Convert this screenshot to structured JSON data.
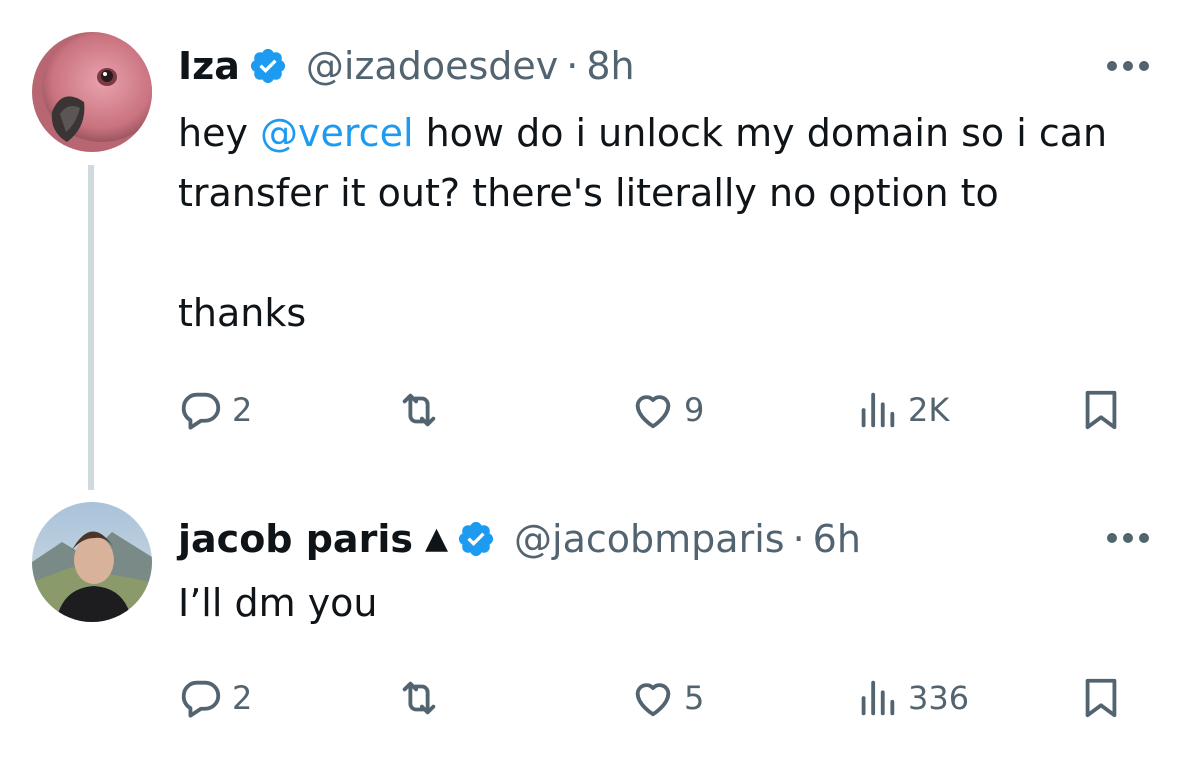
{
  "tweets": [
    {
      "name": "Iza",
      "handle": "@izadoesdev",
      "separator": "·",
      "time": "8h",
      "text_mention": "@vercel",
      "text_pre": "hey ",
      "text_post": " how do i unlock my domain so i can transfer it out? there's literally no option to",
      "text_line2": "thanks",
      "replies": "2",
      "retweets": "",
      "likes": "9",
      "views": "2K"
    },
    {
      "name": "jacob paris",
      "triangle": "▲",
      "handle": "@jacobmparis",
      "separator": "·",
      "time": "6h",
      "text": "I’ll dm you",
      "replies": "2",
      "retweets": "",
      "likes": "5",
      "views": "336"
    }
  ],
  "icons": {
    "verified_color": "#1d9bf0",
    "action_color": "#536471"
  }
}
